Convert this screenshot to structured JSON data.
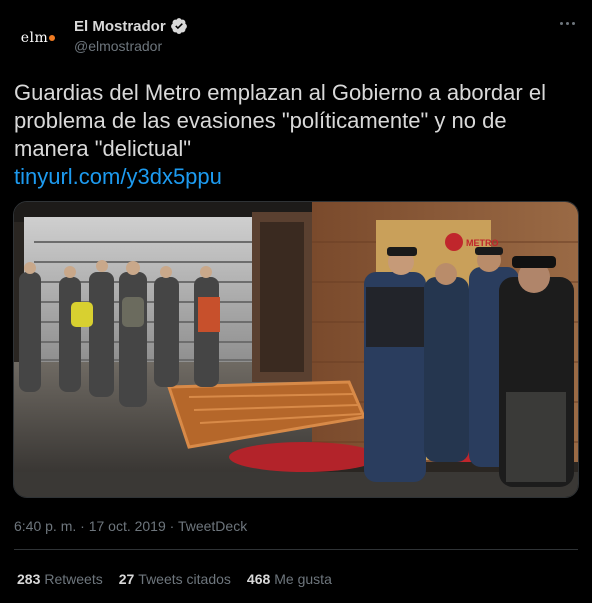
{
  "author": {
    "avatar_text": "elm",
    "avatar_dot_color": "#f07b22",
    "display_name": "El Mostrador",
    "handle": "@elmostrador",
    "verified_icon": "verified-badge-icon"
  },
  "tweet": {
    "text": "Guardias del Metro emplazan al Gobierno a abordar el problema de las evasiones \"políticamente\" y no de manera \"delictual\"",
    "link": "tinyurl.com/y3dx5ppu",
    "link_color": "#1d9bf0",
    "image_sign": "METRO",
    "timestamp": "6:40 p. m. · 17 oct. 2019 · TweetDeck"
  },
  "stats": {
    "retweets_count": "283",
    "retweets_label": "Retweets",
    "quotes_count": "27",
    "quotes_label": "Tweets citados",
    "likes_count": "468",
    "likes_label": "Me gusta"
  }
}
